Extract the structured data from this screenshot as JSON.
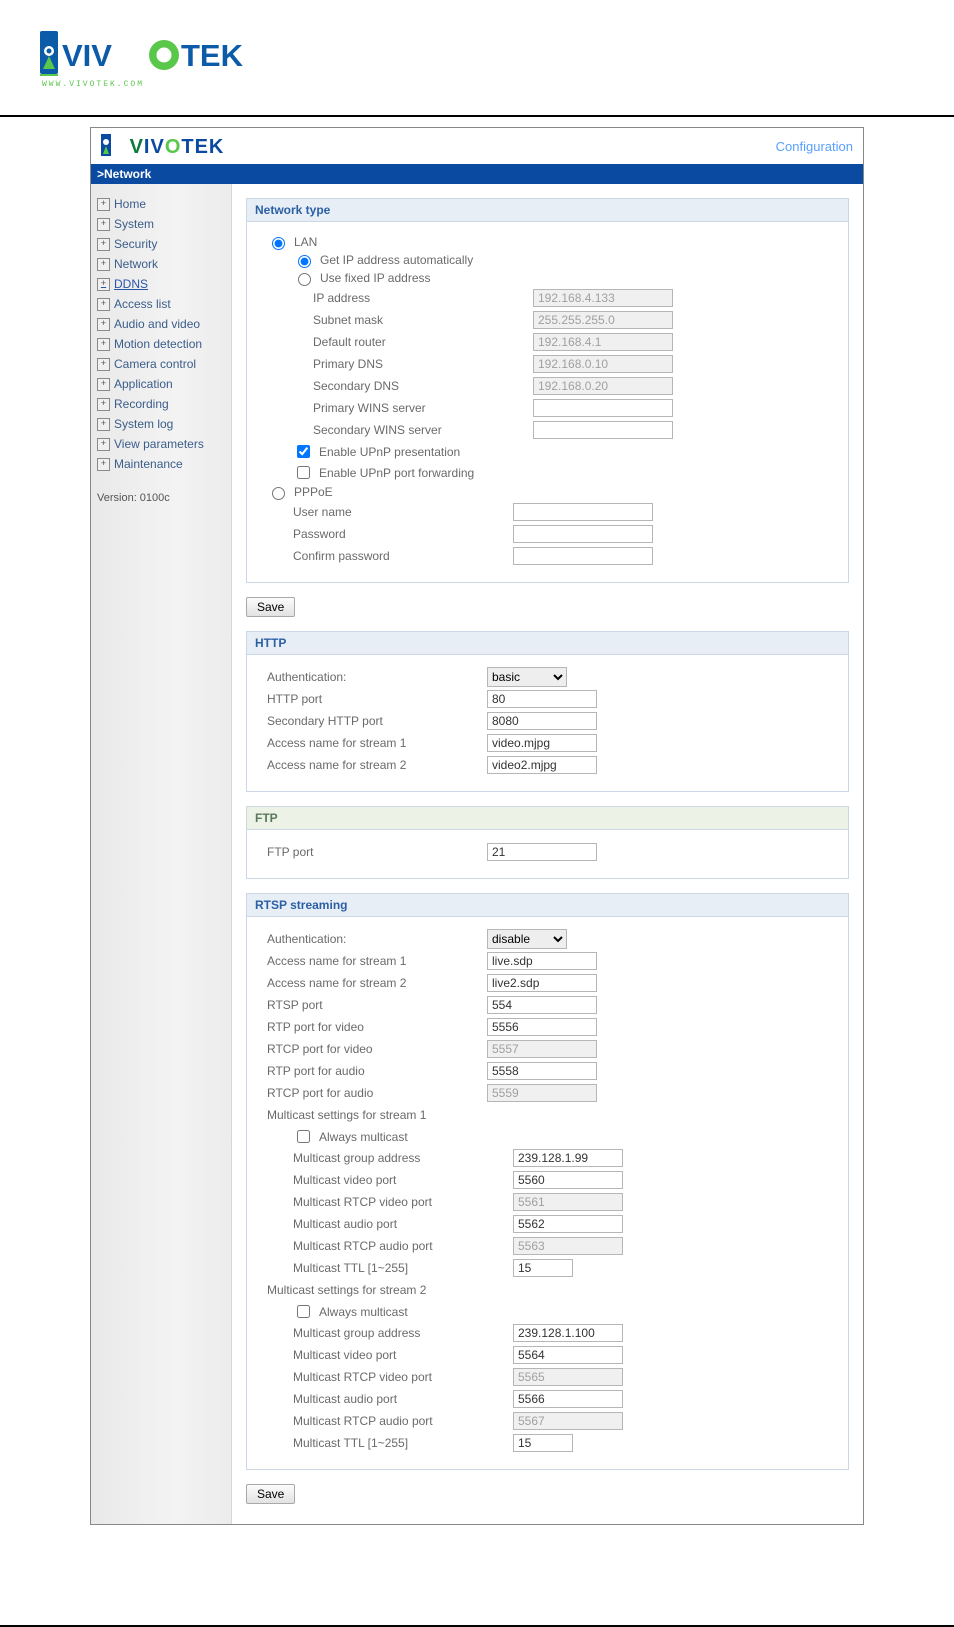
{
  "branding": {
    "brand_v": "V",
    "brand_rest": "IV",
    "brand_o": "O",
    "brand_tek": "TEK",
    "conf_link": "Configuration"
  },
  "breadcrumb": ">Network",
  "nav": {
    "items": [
      {
        "label": "Home"
      },
      {
        "label": "System"
      },
      {
        "label": "Security"
      },
      {
        "label": "Network"
      },
      {
        "label": "DDNS",
        "link": true
      },
      {
        "label": "Access list"
      },
      {
        "label": "Audio and video"
      },
      {
        "label": "Motion detection"
      },
      {
        "label": "Camera control"
      },
      {
        "label": "Application"
      },
      {
        "label": "Recording"
      },
      {
        "label": "System log"
      },
      {
        "label": "View parameters"
      },
      {
        "label": "Maintenance"
      }
    ],
    "version": "Version: 0100c"
  },
  "sections": {
    "network_type": {
      "title": "Network type",
      "lan_label": "LAN",
      "get_ip_label": "Get IP address automatically",
      "fixed_ip_label": "Use fixed IP address",
      "ip_address": {
        "label": "IP address",
        "value": "192.168.4.133"
      },
      "subnet_mask": {
        "label": "Subnet mask",
        "value": "255.255.255.0"
      },
      "default_router": {
        "label": "Default router",
        "value": "192.168.4.1"
      },
      "primary_dns": {
        "label": "Primary DNS",
        "value": "192.168.0.10"
      },
      "secondary_dns": {
        "label": "Secondary DNS",
        "value": "192.168.0.20"
      },
      "primary_wins": {
        "label": "Primary WINS server",
        "value": ""
      },
      "secondary_wins": {
        "label": "Secondary WINS server",
        "value": ""
      },
      "upnp_present": "Enable UPnP presentation",
      "upnp_forward": "Enable UPnP port forwarding",
      "pppoe_label": "PPPoE",
      "user_name": {
        "label": "User name",
        "value": ""
      },
      "password": {
        "label": "Password",
        "value": ""
      },
      "confirm_password": {
        "label": "Confirm password",
        "value": ""
      },
      "save": "Save"
    },
    "http": {
      "title": "HTTP",
      "auth": {
        "label": "Authentication:",
        "value": "basic"
      },
      "http_port": {
        "label": "HTTP port",
        "value": "80"
      },
      "sec_port": {
        "label": "Secondary HTTP port",
        "value": "8080"
      },
      "stream1": {
        "label": "Access name for stream 1",
        "value": "video.mjpg"
      },
      "stream2": {
        "label": "Access name for stream 2",
        "value": "video2.mjpg"
      }
    },
    "ftp": {
      "title": "FTP",
      "port": {
        "label": "FTP port",
        "value": "21"
      }
    },
    "rtsp": {
      "title": "RTSP streaming",
      "auth": {
        "label": "Authentication:",
        "value": "disable"
      },
      "stream1": {
        "label": "Access name for stream 1",
        "value": "live.sdp"
      },
      "stream2": {
        "label": "Access name for stream 2",
        "value": "live2.sdp"
      },
      "rtsp_port": {
        "label": "RTSP port",
        "value": "554"
      },
      "rtp_video": {
        "label": "RTP port for video",
        "value": "5556"
      },
      "rtcp_video": {
        "label": "RTCP port for video",
        "value": "5557"
      },
      "rtp_audio": {
        "label": "RTP port for audio",
        "value": "5558"
      },
      "rtcp_audio": {
        "label": "RTCP port for audio",
        "value": "5559"
      },
      "mcast1_title": "Multicast settings for stream 1",
      "always1": "Always multicast",
      "mcast1_group": {
        "label": "Multicast group address",
        "value": "239.128.1.99"
      },
      "mcast1_video": {
        "label": "Multicast video port",
        "value": "5560"
      },
      "mcast1_rtcp_video": {
        "label": "Multicast RTCP video port",
        "value": "5561"
      },
      "mcast1_audio": {
        "label": "Multicast audio port",
        "value": "5562"
      },
      "mcast1_rtcp_audio": {
        "label": "Multicast RTCP audio port",
        "value": "5563"
      },
      "mcast1_ttl": {
        "label": "Multicast TTL [1~255]",
        "value": "15"
      },
      "mcast2_title": "Multicast settings for stream 2",
      "always2": "Always multicast",
      "mcast2_group": {
        "label": "Multicast group address",
        "value": "239.128.1.100"
      },
      "mcast2_video": {
        "label": "Multicast video port",
        "value": "5564"
      },
      "mcast2_rtcp_video": {
        "label": "Multicast RTCP video port",
        "value": "5565"
      },
      "mcast2_audio": {
        "label": "Multicast audio port",
        "value": "5566"
      },
      "mcast2_rtcp_audio": {
        "label": "Multicast RTCP audio port",
        "value": "5567"
      },
      "mcast2_ttl": {
        "label": "Multicast TTL [1~255]",
        "value": "15"
      },
      "save": "Save"
    }
  }
}
